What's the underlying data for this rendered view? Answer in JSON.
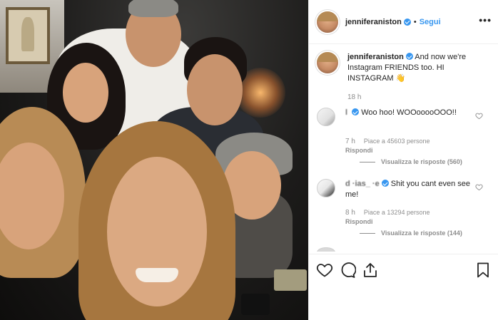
{
  "header": {
    "username": "jenniferaniston",
    "dot": "•",
    "follow_label": "Segui",
    "more_label": "•••"
  },
  "caption": {
    "username": "jenniferaniston",
    "text": "And now we're Instagram FRIENDS too. HI INSTAGRAM 👋",
    "time": "18 h"
  },
  "comments": [
    {
      "username": "l               ",
      "text": "Woo hoo! WOOooooOOO!!",
      "time": "7 h",
      "likes": "Piace a 45603 persone",
      "reply_label": "Rispondi",
      "replies_label": "Visualizza le risposte (560)"
    },
    {
      "username": "d  ·ias_ ·e",
      "text": "Shit you cant even see me!",
      "time": "8 h",
      "likes": "Piace a 13294 persone",
      "reply_label": "Rispondi",
      "replies_label": "Visualizza le risposte (144)"
    }
  ],
  "icons": {
    "like": "heart-icon",
    "comment": "comment-icon",
    "share": "share-icon",
    "save": "bookmark-icon",
    "verified": "verified-badge-icon",
    "more": "more-options-icon"
  },
  "colors": {
    "link": "#3897f0",
    "muted": "#8e8e8e",
    "text": "#262626",
    "border": "#efefef"
  }
}
